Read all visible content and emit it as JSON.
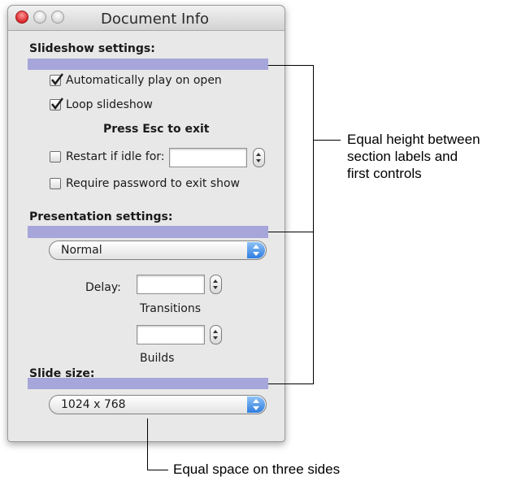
{
  "window": {
    "title": "Document Info"
  },
  "slideshow": {
    "section_label": "Slideshow settings:",
    "auto_play_label": "Automatically play on open",
    "auto_play_checked": true,
    "loop_label": "Loop slideshow",
    "loop_checked": true,
    "esc_note": "Press Esc to exit",
    "restart_label": "Restart if idle for:",
    "restart_checked": false,
    "restart_value": "",
    "password_label": "Require password to exit show",
    "password_checked": false
  },
  "presentation": {
    "section_label": "Presentation settings:",
    "mode_selected": "Normal",
    "delay_label": "Delay:",
    "transitions_value": "",
    "transitions_label": "Transitions",
    "builds_value": "",
    "builds_label": "Builds"
  },
  "slide_size": {
    "section_label": "Slide size:",
    "selected": "1024 x 768"
  },
  "annotations": {
    "equal_height": "Equal height between section labels and first controls",
    "equal_height_lines": [
      "Equal height between",
      "section labels and",
      "first controls"
    ],
    "equal_space": "Equal space on three sides"
  },
  "colors": {
    "highlight": "#a6a6da",
    "margin_band": "#c8aec8",
    "popup_arrow": "#2e7de0"
  }
}
